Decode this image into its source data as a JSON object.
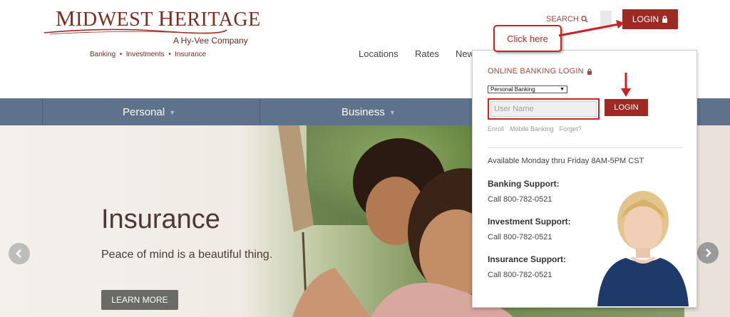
{
  "brand": {
    "title_big_m": "M",
    "title_rest_1": "IDWEST ",
    "title_big_h": "H",
    "title_rest_2": "ERITAGE",
    "subtitle": "A Hy-Vee Company",
    "tagline": "Banking  •  Investments  •  Insurance",
    "color": "#7d2a1f"
  },
  "header": {
    "search_label": "SEARCH",
    "login_label": "LOGIN",
    "nav": [
      "Locations",
      "Rates",
      "New"
    ]
  },
  "main_nav": {
    "items": [
      "Personal",
      "Business"
    ]
  },
  "hero": {
    "title": "Insurance",
    "subtitle": "Peace of mind is a beautiful thing.",
    "button_label": "LEARN MORE"
  },
  "login_panel": {
    "title": "ONLINE BANKING LOGIN",
    "select_value": "Personal Banking",
    "username_placeholder": "User Name",
    "login_label": "LOGIN",
    "links": [
      "Enroll",
      "Mobile Banking",
      "Forget?"
    ],
    "availability": "Available Monday thru Friday 8AM-5PM CST",
    "support": [
      {
        "heading": "Banking Support:",
        "phone": "Call 800-782-0521"
      },
      {
        "heading": "Investment Support:",
        "phone": "Call 800-782-0521"
      },
      {
        "heading": "Insurance Support:",
        "phone": "Call 800-782-0521"
      }
    ]
  },
  "annotation": {
    "callout_text": "Click here",
    "color": "#d01f1f"
  },
  "colors": {
    "accent_red": "#9e2a24",
    "nav_bar": "#5f728b"
  }
}
